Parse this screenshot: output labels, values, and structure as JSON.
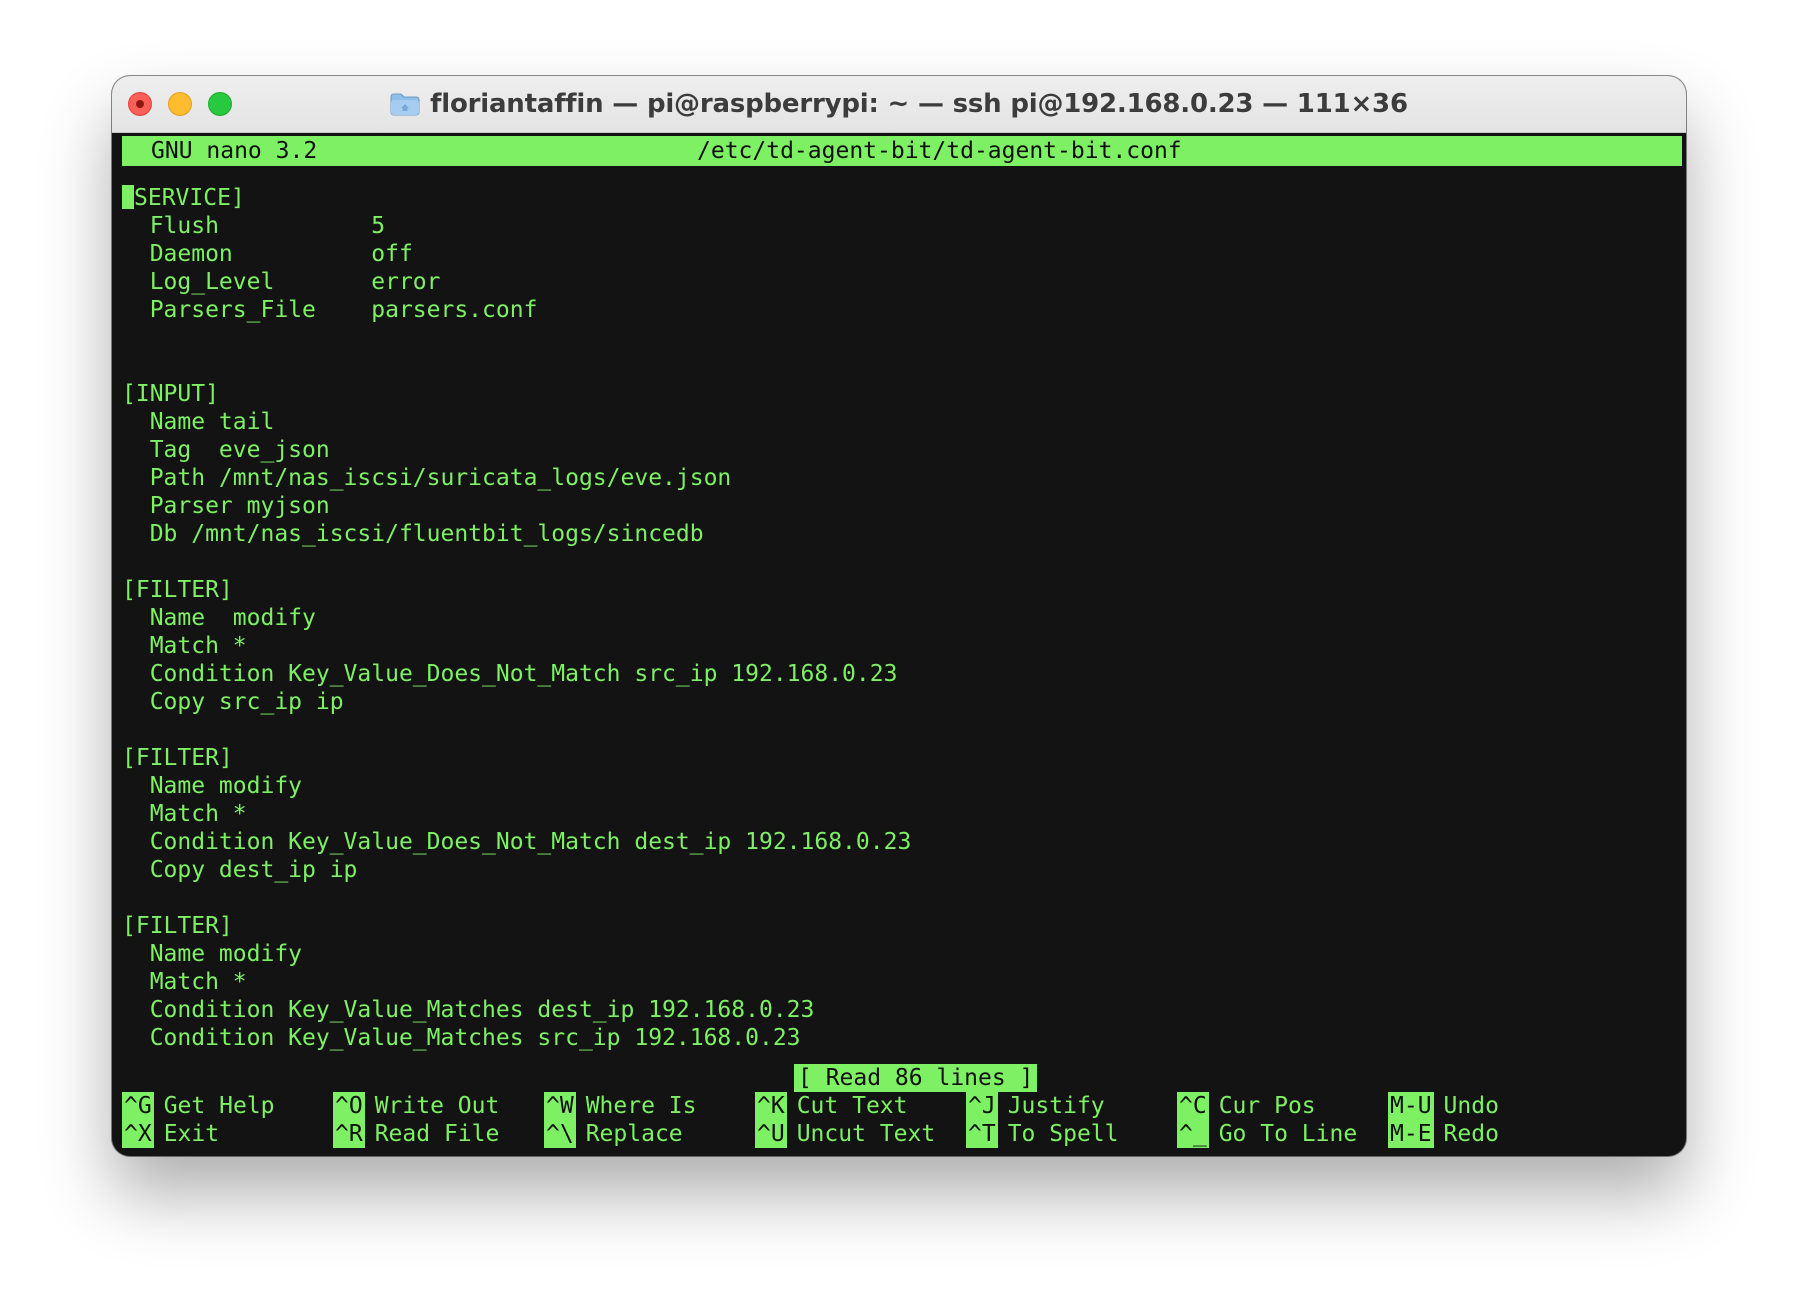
{
  "window": {
    "title": "floriantaffin — pi@raspberrypi: ~ — ssh pi@192.168.0.23 — 111×36"
  },
  "nano": {
    "version": "GNU nano 3.2",
    "filename": "/etc/td-agent-bit/td-agent-bit.conf",
    "status_message": "[ Read 86 lines ]",
    "cursor_line": 1,
    "cursor_col": 1
  },
  "file_lines": [
    "SERVICE]",
    "  Flush           5",
    "  Daemon          off",
    "  Log_Level       error",
    "  Parsers_File    parsers.conf",
    "",
    "",
    "[INPUT]",
    "  Name tail",
    "  Tag  eve_json",
    "  Path /mnt/nas_iscsi/suricata_logs/eve.json",
    "  Parser myjson",
    "  Db /mnt/nas_iscsi/fluentbit_logs/sincedb",
    "",
    "[FILTER]",
    "  Name  modify",
    "  Match *",
    "  Condition Key_Value_Does_Not_Match src_ip 192.168.0.23",
    "  Copy src_ip ip",
    "",
    "[FILTER]",
    "  Name modify",
    "  Match *",
    "  Condition Key_Value_Does_Not_Match dest_ip 192.168.0.23",
    "  Copy dest_ip ip",
    "",
    "[FILTER]",
    "  Name modify",
    "  Match *",
    "  Condition Key_Value_Matches dest_ip 192.168.0.23",
    "  Condition Key_Value_Matches src_ip 192.168.0.23"
  ],
  "shortcuts": [
    {
      "key": "^G",
      "label": "Get Help"
    },
    {
      "key": "^X",
      "label": "Exit"
    },
    {
      "key": "^O",
      "label": "Write Out"
    },
    {
      "key": "^R",
      "label": "Read File"
    },
    {
      "key": "^W",
      "label": "Where Is"
    },
    {
      "key": "^\\",
      "label": "Replace"
    },
    {
      "key": "^K",
      "label": "Cut Text"
    },
    {
      "key": "^U",
      "label": "Uncut Text"
    },
    {
      "key": "^J",
      "label": "Justify"
    },
    {
      "key": "^T",
      "label": "To Spell"
    },
    {
      "key": "^C",
      "label": "Cur Pos"
    },
    {
      "key": "^_",
      "label": "Go To Line"
    },
    {
      "key": "M-U",
      "label": "Undo"
    },
    {
      "key": "M-E",
      "label": "Redo"
    }
  ],
  "colors": {
    "terminal_fg": "#7df163",
    "terminal_bg": "#131313",
    "close": "#ff5f57",
    "minimize": "#febc2e",
    "maximize": "#28c840"
  },
  "icons": {
    "title_icon": "folder-icon"
  }
}
